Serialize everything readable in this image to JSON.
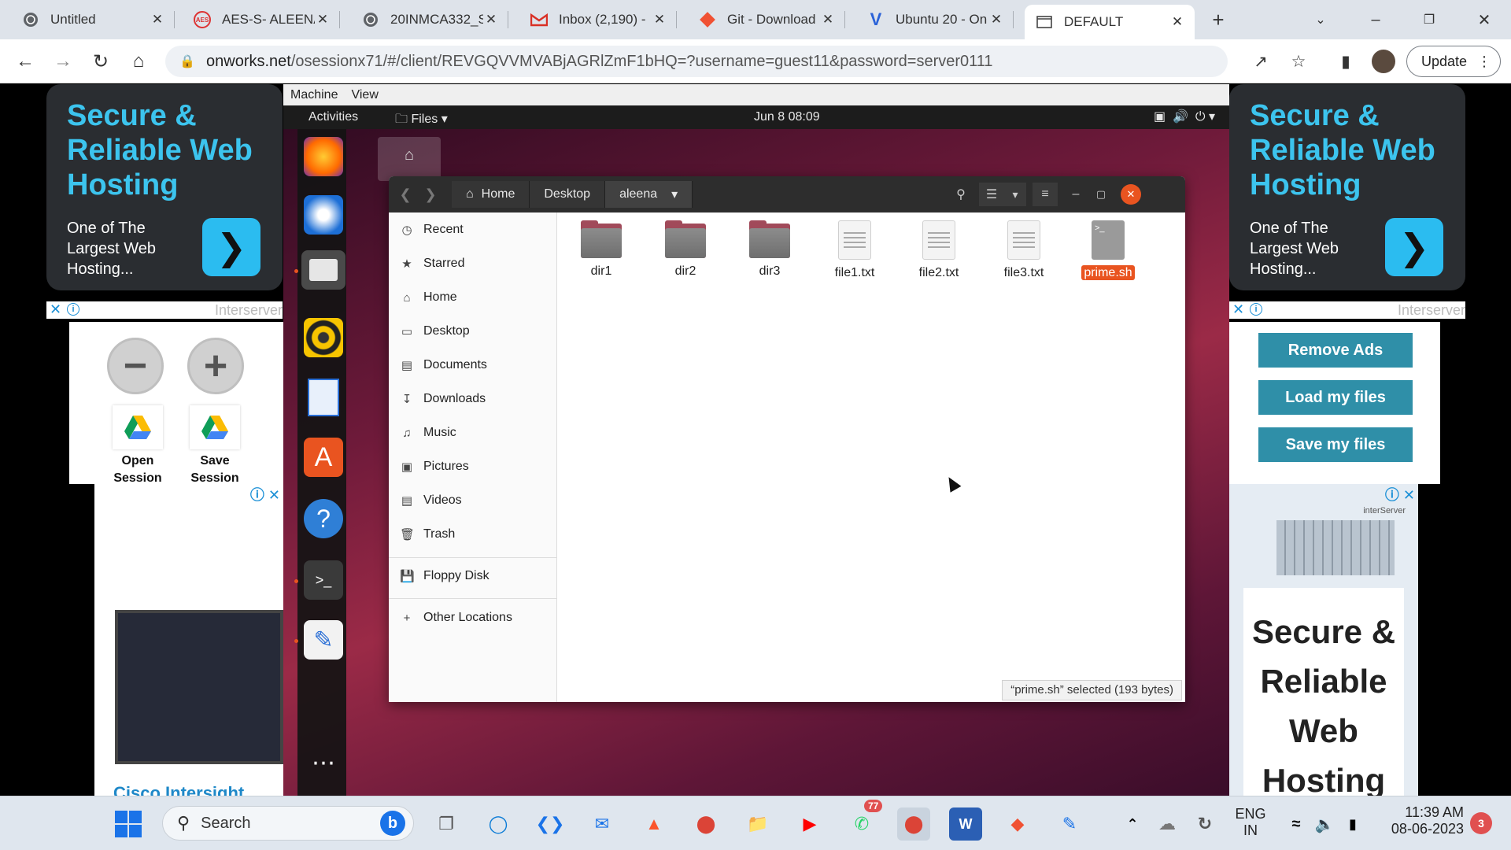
{
  "browser": {
    "tabs": [
      {
        "title": "Untitled",
        "icon": "globe-icon"
      },
      {
        "title": "AES-S- ALEENA",
        "icon": "aes-icon"
      },
      {
        "title": "20INMCA332_S",
        "icon": "globe-icon"
      },
      {
        "title": "Inbox (2,190) -",
        "icon": "gmail-icon"
      },
      {
        "title": "Git - Download",
        "icon": "git-icon"
      },
      {
        "title": "Ubuntu 20 - On",
        "icon": "ubuntu-v-icon"
      },
      {
        "title": "DEFAULT",
        "icon": "window-icon"
      }
    ],
    "url_host": "onworks.net",
    "url_path": "/osessionx71/#/client/REVGQVVMVABjAGRlZmF1bHQ=?username=guest11&password=server0111",
    "update_label": "Update",
    "close_glyph": "✕",
    "new_tab_glyph": "+"
  },
  "ads": {
    "left_title": "Secure & Reliable Web Hosting",
    "left_sub": "One of The Largest Web Hosting...",
    "right_title": "Secure & Reliable Web Hosting",
    "right_sub": "One of The Largest Web Hosting...",
    "brand": "Interserver",
    "cisco": "Cisco Intersight",
    "hosting_card": "Secure & Reliable Web Hosting",
    "interserver_small": "interServer"
  },
  "session": {
    "open_label": "Open Session",
    "save_label": "Save Session"
  },
  "side_buttons": {
    "remove_ads": "Remove Ads",
    "load_files": "Load my files",
    "save_files": "Save my files"
  },
  "vm": {
    "menu": [
      "Machine",
      "View"
    ],
    "topbar": {
      "activities": "Activities",
      "files": "Files",
      "clock": "Jun 8  08:09"
    }
  },
  "nautilus": {
    "path": [
      "Home",
      "Desktop",
      "aleena"
    ],
    "sidebar": [
      "Recent",
      "Starred",
      "Home",
      "Desktop",
      "Documents",
      "Downloads",
      "Music",
      "Pictures",
      "Videos",
      "Trash",
      "Floppy Disk",
      "Other Locations"
    ],
    "files": [
      {
        "name": "dir1",
        "type": "folder"
      },
      {
        "name": "dir2",
        "type": "folder"
      },
      {
        "name": "dir3",
        "type": "folder"
      },
      {
        "name": "file1.txt",
        "type": "text"
      },
      {
        "name": "file2.txt",
        "type": "text"
      },
      {
        "name": "file3.txt",
        "type": "text"
      },
      {
        "name": "prime.sh",
        "type": "script",
        "selected": true
      }
    ],
    "status": "“prime.sh” selected  (193 bytes)"
  },
  "taskbar": {
    "search_label": "Search",
    "whatsapp_badge": "77",
    "lang1": "ENG",
    "lang2": "IN",
    "time": "11:39 AM",
    "date": "08-06-2023",
    "notif_count": "3"
  },
  "colors": {
    "accent_orange": "#e95420",
    "ad_cyan": "#3cc4ee",
    "button_teal": "#2f8fa8"
  }
}
